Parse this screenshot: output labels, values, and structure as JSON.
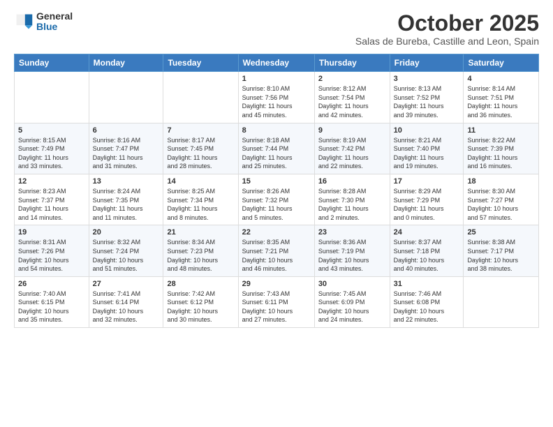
{
  "logo": {
    "general": "General",
    "blue": "Blue"
  },
  "header": {
    "month_title": "October 2025",
    "subtitle": "Salas de Bureba, Castille and Leon, Spain"
  },
  "days_of_week": [
    "Sunday",
    "Monday",
    "Tuesday",
    "Wednesday",
    "Thursday",
    "Friday",
    "Saturday"
  ],
  "weeks": [
    [
      {
        "day": "",
        "info": ""
      },
      {
        "day": "",
        "info": ""
      },
      {
        "day": "",
        "info": ""
      },
      {
        "day": "1",
        "info": "Sunrise: 8:10 AM\nSunset: 7:56 PM\nDaylight: 11 hours\nand 45 minutes."
      },
      {
        "day": "2",
        "info": "Sunrise: 8:12 AM\nSunset: 7:54 PM\nDaylight: 11 hours\nand 42 minutes."
      },
      {
        "day": "3",
        "info": "Sunrise: 8:13 AM\nSunset: 7:52 PM\nDaylight: 11 hours\nand 39 minutes."
      },
      {
        "day": "4",
        "info": "Sunrise: 8:14 AM\nSunset: 7:51 PM\nDaylight: 11 hours\nand 36 minutes."
      }
    ],
    [
      {
        "day": "5",
        "info": "Sunrise: 8:15 AM\nSunset: 7:49 PM\nDaylight: 11 hours\nand 33 minutes."
      },
      {
        "day": "6",
        "info": "Sunrise: 8:16 AM\nSunset: 7:47 PM\nDaylight: 11 hours\nand 31 minutes."
      },
      {
        "day": "7",
        "info": "Sunrise: 8:17 AM\nSunset: 7:45 PM\nDaylight: 11 hours\nand 28 minutes."
      },
      {
        "day": "8",
        "info": "Sunrise: 8:18 AM\nSunset: 7:44 PM\nDaylight: 11 hours\nand 25 minutes."
      },
      {
        "day": "9",
        "info": "Sunrise: 8:19 AM\nSunset: 7:42 PM\nDaylight: 11 hours\nand 22 minutes."
      },
      {
        "day": "10",
        "info": "Sunrise: 8:21 AM\nSunset: 7:40 PM\nDaylight: 11 hours\nand 19 minutes."
      },
      {
        "day": "11",
        "info": "Sunrise: 8:22 AM\nSunset: 7:39 PM\nDaylight: 11 hours\nand 16 minutes."
      }
    ],
    [
      {
        "day": "12",
        "info": "Sunrise: 8:23 AM\nSunset: 7:37 PM\nDaylight: 11 hours\nand 14 minutes."
      },
      {
        "day": "13",
        "info": "Sunrise: 8:24 AM\nSunset: 7:35 PM\nDaylight: 11 hours\nand 11 minutes."
      },
      {
        "day": "14",
        "info": "Sunrise: 8:25 AM\nSunset: 7:34 PM\nDaylight: 11 hours\nand 8 minutes."
      },
      {
        "day": "15",
        "info": "Sunrise: 8:26 AM\nSunset: 7:32 PM\nDaylight: 11 hours\nand 5 minutes."
      },
      {
        "day": "16",
        "info": "Sunrise: 8:28 AM\nSunset: 7:30 PM\nDaylight: 11 hours\nand 2 minutes."
      },
      {
        "day": "17",
        "info": "Sunrise: 8:29 AM\nSunset: 7:29 PM\nDaylight: 11 hours\nand 0 minutes."
      },
      {
        "day": "18",
        "info": "Sunrise: 8:30 AM\nSunset: 7:27 PM\nDaylight: 10 hours\nand 57 minutes."
      }
    ],
    [
      {
        "day": "19",
        "info": "Sunrise: 8:31 AM\nSunset: 7:26 PM\nDaylight: 10 hours\nand 54 minutes."
      },
      {
        "day": "20",
        "info": "Sunrise: 8:32 AM\nSunset: 7:24 PM\nDaylight: 10 hours\nand 51 minutes."
      },
      {
        "day": "21",
        "info": "Sunrise: 8:34 AM\nSunset: 7:23 PM\nDaylight: 10 hours\nand 48 minutes."
      },
      {
        "day": "22",
        "info": "Sunrise: 8:35 AM\nSunset: 7:21 PM\nDaylight: 10 hours\nand 46 minutes."
      },
      {
        "day": "23",
        "info": "Sunrise: 8:36 AM\nSunset: 7:19 PM\nDaylight: 10 hours\nand 43 minutes."
      },
      {
        "day": "24",
        "info": "Sunrise: 8:37 AM\nSunset: 7:18 PM\nDaylight: 10 hours\nand 40 minutes."
      },
      {
        "day": "25",
        "info": "Sunrise: 8:38 AM\nSunset: 7:17 PM\nDaylight: 10 hours\nand 38 minutes."
      }
    ],
    [
      {
        "day": "26",
        "info": "Sunrise: 7:40 AM\nSunset: 6:15 PM\nDaylight: 10 hours\nand 35 minutes."
      },
      {
        "day": "27",
        "info": "Sunrise: 7:41 AM\nSunset: 6:14 PM\nDaylight: 10 hours\nand 32 minutes."
      },
      {
        "day": "28",
        "info": "Sunrise: 7:42 AM\nSunset: 6:12 PM\nDaylight: 10 hours\nand 30 minutes."
      },
      {
        "day": "29",
        "info": "Sunrise: 7:43 AM\nSunset: 6:11 PM\nDaylight: 10 hours\nand 27 minutes."
      },
      {
        "day": "30",
        "info": "Sunrise: 7:45 AM\nSunset: 6:09 PM\nDaylight: 10 hours\nand 24 minutes."
      },
      {
        "day": "31",
        "info": "Sunrise: 7:46 AM\nSunset: 6:08 PM\nDaylight: 10 hours\nand 22 minutes."
      },
      {
        "day": "",
        "info": ""
      }
    ]
  ]
}
